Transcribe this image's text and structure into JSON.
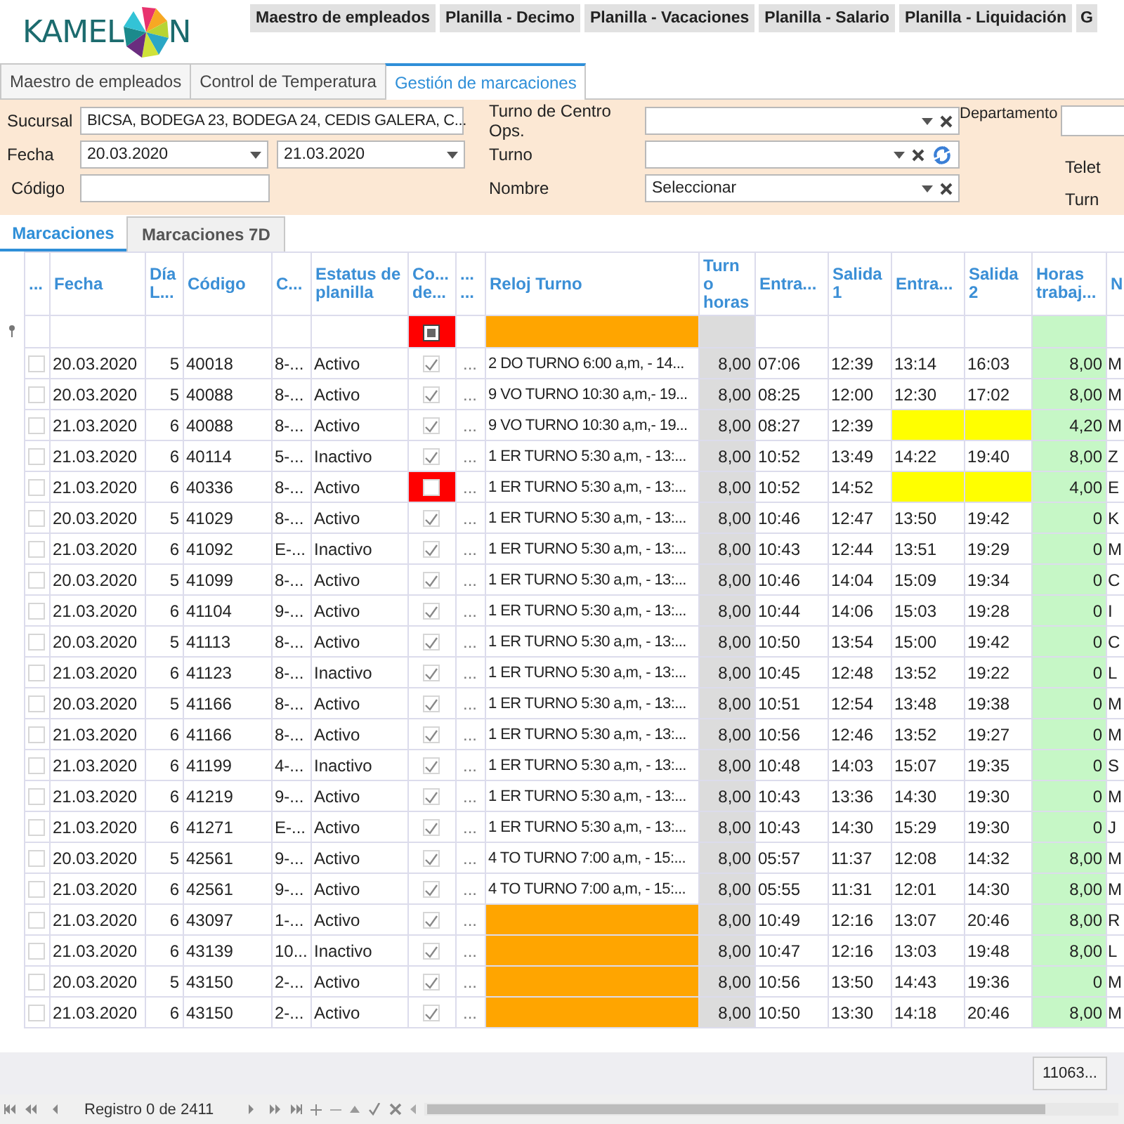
{
  "logo": {
    "left": "KAMEL",
    "right": "N"
  },
  "nav_buttons": [
    "Maestro de empleados",
    "Planilla - Decimo",
    "Planilla - Vacaciones",
    "Planilla - Salario",
    "Planilla - Liquidación",
    "G"
  ],
  "tabs": [
    {
      "label": "Maestro de empleados",
      "selected": false
    },
    {
      "label": "Control de Temperatura",
      "selected": false
    },
    {
      "label": "Gestión de marcaciones",
      "selected": true
    }
  ],
  "filters": {
    "sucursal": {
      "label": "Sucursal",
      "value": "BICSA, BODEGA 23, BODEGA 24, CEDIS GALERA, C..."
    },
    "fecha": {
      "label": "Fecha",
      "from": "20.03.2020",
      "to": "21.03.2020"
    },
    "codigo": {
      "label": "Código"
    },
    "turno_centro": {
      "label": "Turno de Centro Ops."
    },
    "turno": {
      "label": "Turno"
    },
    "nombre": {
      "label": "Nombre",
      "value": "Seleccionar"
    },
    "departamento": {
      "label": "Departamento"
    },
    "cut_labels": [
      "Telet",
      "Turn"
    ]
  },
  "subtabs": [
    {
      "label": "Marcaciones",
      "selected": true
    },
    {
      "label": "Marcaciones 7D",
      "selected": false
    }
  ],
  "table": {
    "columns": [
      "...",
      "Fecha",
      "Día L...",
      "Código",
      "C...",
      "Estatus de planilla",
      "Co... de...",
      "... ...",
      "Reloj Turno",
      "Turno horas",
      "Entra...",
      "Salida 1",
      "Entra...",
      "Salida 2",
      "Horas trabaj...",
      "N"
    ],
    "filter_indeterminate": true,
    "rows": [
      {
        "selected": false,
        "fecha": "20.03.2020",
        "dia": "5",
        "codigo": "40018",
        "c": "8-...",
        "estatus": "Activo",
        "checked": true,
        "col_8": "...",
        "reloj_turno": "2 DO TURNO 6:00 a,m, - 14...",
        "turno_horas": "8,00",
        "entrada_1": "07:06",
        "salida_1": "12:39",
        "entrada_2": "13:14",
        "salida_2": "16:03",
        "horas": "8,00",
        "n": "M"
      },
      {
        "selected": false,
        "fecha": "20.03.2020",
        "dia": "5",
        "codigo": "40088",
        "c": "8-...",
        "estatus": "Activo",
        "checked": true,
        "col_8": "...",
        "reloj_turno": "9 VO TURNO 10:30 a,m,- 19...",
        "turno_horas": "8,00",
        "entrada_1": "08:25",
        "salida_1": "12:00",
        "entrada_2": "12:30",
        "salida_2": "17:02",
        "horas": "8,00",
        "n": "M"
      },
      {
        "selected": false,
        "fecha": "21.03.2020",
        "dia": "6",
        "codigo": "40088",
        "c": "8-...",
        "estatus": "Activo",
        "checked": true,
        "col_8": "...",
        "reloj_turno": "9 VO TURNO 10:30 a,m,- 19...",
        "turno_horas": "8,00",
        "entrada_1": "08:27",
        "salida_1": "12:39",
        "horas": "4,20",
        "n": "M"
      },
      {
        "selected": false,
        "fecha": "21.03.2020",
        "dia": "6",
        "codigo": "40114",
        "c": "5-...",
        "estatus": "Inactivo",
        "checked": true,
        "col_8": "...",
        "reloj_turno": "1 ER TURNO 5:30 a,m, - 13:...",
        "turno_horas": "8,00",
        "entrada_1": "10:52",
        "salida_1": "13:49",
        "entrada_2": "14:22",
        "salida_2": "19:40",
        "horas": "8,00",
        "n": "Z"
      },
      {
        "selected": false,
        "fecha": "21.03.2020",
        "dia": "6",
        "codigo": "40336",
        "c": "8-...",
        "estatus": "Activo",
        "checked": false,
        "col_8": "...",
        "reloj_turno": "1 ER TURNO 5:30 a,m, - 13:...",
        "turno_horas": "8,00",
        "entrada_1": "10:52",
        "salida_1": "14:52",
        "horas": "4,00",
        "n": "E"
      },
      {
        "selected": false,
        "fecha": "20.03.2020",
        "dia": "5",
        "codigo": "41029",
        "c": "8-...",
        "estatus": "Activo",
        "checked": true,
        "col_8": "...",
        "reloj_turno": "1 ER TURNO 5:30 a,m, - 13:...",
        "turno_horas": "8,00",
        "entrada_1": "10:46",
        "salida_1": "12:47",
        "entrada_2": "13:50",
        "salida_2": "19:42",
        "horas": "0",
        "n": "K"
      },
      {
        "selected": false,
        "fecha": "21.03.2020",
        "dia": "6",
        "codigo": "41092",
        "c": "E-...",
        "estatus": "Inactivo",
        "checked": true,
        "col_8": "...",
        "reloj_turno": "1 ER TURNO 5:30 a,m, - 13:...",
        "turno_horas": "8,00",
        "entrada_1": "10:43",
        "salida_1": "12:44",
        "entrada_2": "13:51",
        "salida_2": "19:29",
        "horas": "0",
        "n": "M"
      },
      {
        "selected": false,
        "fecha": "20.03.2020",
        "dia": "5",
        "codigo": "41099",
        "c": "8-...",
        "estatus": "Activo",
        "checked": true,
        "col_8": "...",
        "reloj_turno": "1 ER TURNO 5:30 a,m, - 13:...",
        "turno_horas": "8,00",
        "entrada_1": "10:46",
        "salida_1": "14:04",
        "entrada_2": "15:09",
        "salida_2": "19:34",
        "horas": "0",
        "n": "C"
      },
      {
        "selected": false,
        "fecha": "21.03.2020",
        "dia": "6",
        "codigo": "41104",
        "c": "9-...",
        "estatus": "Activo",
        "checked": true,
        "col_8": "...",
        "reloj_turno": "1 ER TURNO 5:30 a,m, - 13:...",
        "turno_horas": "8,00",
        "entrada_1": "10:44",
        "salida_1": "14:06",
        "entrada_2": "15:03",
        "salida_2": "19:28",
        "horas": "0",
        "n": "I"
      },
      {
        "selected": false,
        "fecha": "20.03.2020",
        "dia": "5",
        "codigo": "41113",
        "c": "8-...",
        "estatus": "Activo",
        "checked": true,
        "col_8": "...",
        "reloj_turno": "1 ER TURNO 5:30 a,m, - 13:...",
        "turno_horas": "8,00",
        "entrada_1": "10:50",
        "salida_1": "13:54",
        "entrada_2": "15:00",
        "salida_2": "19:42",
        "horas": "0",
        "n": "C"
      },
      {
        "selected": false,
        "fecha": "21.03.2020",
        "dia": "6",
        "codigo": "41123",
        "c": "8-...",
        "estatus": "Inactivo",
        "checked": true,
        "col_8": "...",
        "reloj_turno": "1 ER TURNO 5:30 a,m, - 13:...",
        "turno_horas": "8,00",
        "entrada_1": "10:45",
        "salida_1": "12:48",
        "entrada_2": "13:52",
        "salida_2": "19:22",
        "horas": "0",
        "n": "L"
      },
      {
        "selected": false,
        "fecha": "20.03.2020",
        "dia": "5",
        "codigo": "41166",
        "c": "8-...",
        "estatus": "Activo",
        "checked": true,
        "col_8": "...",
        "reloj_turno": "1 ER TURNO 5:30 a,m, - 13:...",
        "turno_horas": "8,00",
        "entrada_1": "10:51",
        "salida_1": "12:54",
        "entrada_2": "13:48",
        "salida_2": "19:38",
        "horas": "0",
        "n": "M"
      },
      {
        "selected": false,
        "fecha": "21.03.2020",
        "dia": "6",
        "codigo": "41166",
        "c": "8-...",
        "estatus": "Activo",
        "checked": true,
        "col_8": "...",
        "reloj_turno": "1 ER TURNO 5:30 a,m, - 13:...",
        "turno_horas": "8,00",
        "entrada_1": "10:56",
        "salida_1": "12:46",
        "entrada_2": "13:52",
        "salida_2": "19:27",
        "horas": "0",
        "n": "M"
      },
      {
        "selected": false,
        "fecha": "21.03.2020",
        "dia": "6",
        "codigo": "41199",
        "c": "4-...",
        "estatus": "Inactivo",
        "checked": true,
        "col_8": "...",
        "reloj_turno": "1 ER TURNO 5:30 a,m, - 13:...",
        "turno_horas": "8,00",
        "entrada_1": "10:48",
        "salida_1": "14:03",
        "entrada_2": "15:07",
        "salida_2": "19:35",
        "horas": "0",
        "n": "S"
      },
      {
        "selected": false,
        "fecha": "21.03.2020",
        "dia": "6",
        "codigo": "41219",
        "c": "9-...",
        "estatus": "Activo",
        "checked": true,
        "col_8": "...",
        "reloj_turno": "1 ER TURNO 5:30 a,m, - 13:...",
        "turno_horas": "8,00",
        "entrada_1": "10:43",
        "salida_1": "13:36",
        "entrada_2": "14:30",
        "salida_2": "19:30",
        "horas": "0",
        "n": "M"
      },
      {
        "selected": false,
        "fecha": "21.03.2020",
        "dia": "6",
        "codigo": "41271",
        "c": "E-...",
        "estatus": "Activo",
        "checked": true,
        "col_8": "...",
        "reloj_turno": "1 ER TURNO 5:30 a,m, - 13:...",
        "turno_horas": "8,00",
        "entrada_1": "10:43",
        "salida_1": "14:30",
        "entrada_2": "15:29",
        "salida_2": "19:30",
        "horas": "0",
        "n": "J"
      },
      {
        "selected": false,
        "fecha": "20.03.2020",
        "dia": "5",
        "codigo": "42561",
        "c": "9-...",
        "estatus": "Activo",
        "checked": true,
        "col_8": "...",
        "reloj_turno": "4 TO TURNO 7:00 a,m, - 15:...",
        "turno_horas": "8,00",
        "entrada_1": "05:57",
        "salida_1": "11:37",
        "entrada_2": "12:08",
        "salida_2": "14:32",
        "horas": "8,00",
        "n": "M"
      },
      {
        "selected": false,
        "fecha": "21.03.2020",
        "dia": "6",
        "codigo": "42561",
        "c": "9-...",
        "estatus": "Activo",
        "checked": true,
        "col_8": "...",
        "reloj_turno": "4 TO TURNO 7:00 a,m, - 15:...",
        "turno_horas": "8,00",
        "entrada_1": "05:55",
        "salida_1": "11:31",
        "entrada_2": "12:01",
        "salida_2": "14:30",
        "horas": "8,00",
        "n": "M"
      },
      {
        "selected": false,
        "fecha": "21.03.2020",
        "dia": "6",
        "codigo": "43097",
        "c": "1-...",
        "estatus": "Activo",
        "checked": true,
        "col_8": "...",
        "turno_horas": "8,00",
        "entrada_1": "10:49",
        "salida_1": "12:16",
        "entrada_2": "13:07",
        "salida_2": "20:46",
        "horas": "8,00",
        "n": "R"
      },
      {
        "selected": false,
        "fecha": "21.03.2020",
        "dia": "6",
        "codigo": "43139",
        "c": "10...",
        "estatus": "Inactivo",
        "checked": true,
        "col_8": "...",
        "turno_horas": "8,00",
        "entrada_1": "10:47",
        "salida_1": "12:16",
        "entrada_2": "13:03",
        "salida_2": "19:48",
        "horas": "8,00",
        "n": "L"
      },
      {
        "selected": false,
        "fecha": "20.03.2020",
        "dia": "5",
        "codigo": "43150",
        "c": "2-...",
        "estatus": "Activo",
        "checked": true,
        "col_8": "...",
        "turno_horas": "8,00",
        "entrada_1": "10:56",
        "salida_1": "13:50",
        "entrada_2": "14:43",
        "salida_2": "19:36",
        "horas": "0",
        "n": "M"
      },
      {
        "selected": false,
        "fecha": "21.03.2020",
        "dia": "6",
        "codigo": "43150",
        "c": "2-...",
        "estatus": "Activo",
        "checked": true,
        "col_8": "...",
        "turno_horas": "8,00",
        "entrada_1": "10:50",
        "salida_1": "13:30",
        "entrada_2": "14:18",
        "salida_2": "20:46",
        "horas": "8,00",
        "n": "M"
      }
    ]
  },
  "summary_total": "11063...",
  "navigator": {
    "text": "Registro 0 de 2411"
  }
}
